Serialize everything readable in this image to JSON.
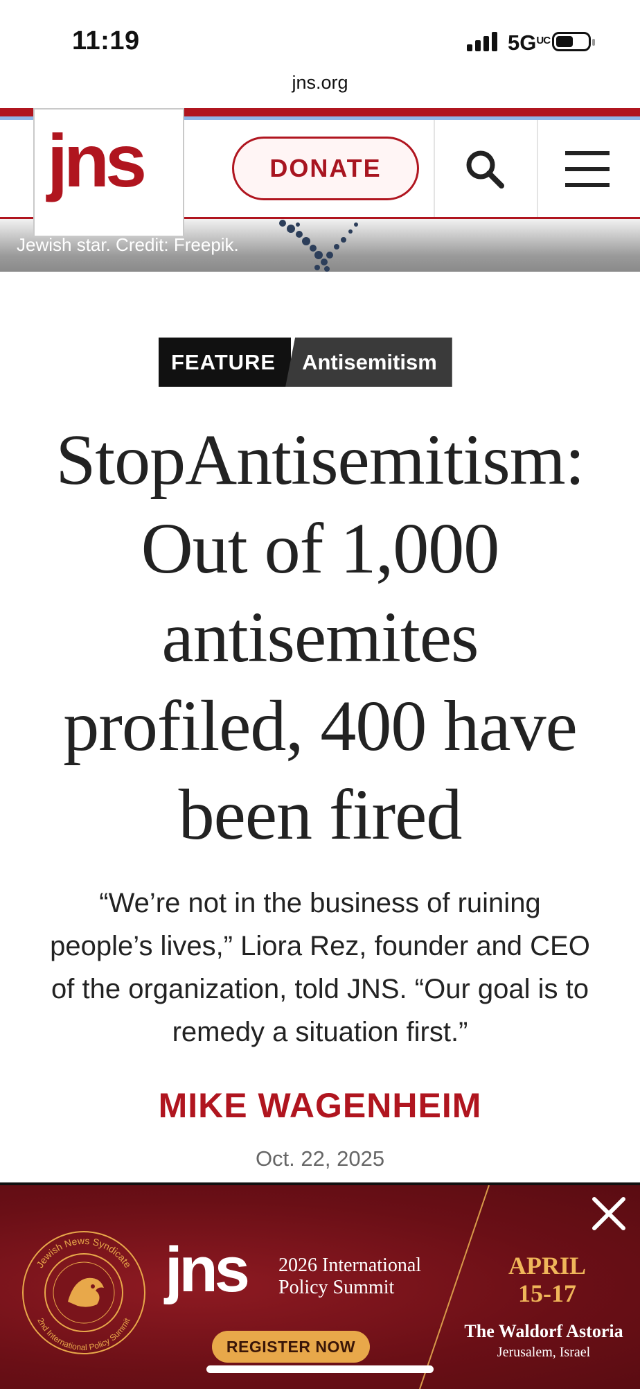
{
  "status_bar": {
    "time": "11:19",
    "network": "5G",
    "network_suffix": "UC"
  },
  "browser": {
    "url": "jns.org"
  },
  "site_header": {
    "logo": "jns",
    "donate_label": "DONATE"
  },
  "hero": {
    "caption": "Jewish star. Credit: Freepik."
  },
  "article": {
    "tag_feature": "FEATURE",
    "tag_topic": "Antisemitism",
    "headline_lines": [
      "StopAntisemitism:",
      "Out of 1,000",
      "antisemites",
      "profiled, 400 have",
      "been fired"
    ],
    "dek_lines": [
      "“We’re not in the business of ruining",
      "people’s lives,” Liora Rez, founder and CEO",
      "of the organization, told JNS. “Our goal is to",
      "remedy a situation first.”"
    ],
    "author": "MIKE WAGENHEIM",
    "date": "Oct. 22, 2025"
  },
  "ad": {
    "logo": "jns",
    "summit_line1": "2026 International",
    "summit_line2": "Policy Summit",
    "register_label": "REGISTER NOW",
    "month": "APRIL",
    "days": "15-17",
    "venue": "The Waldorf Astoria",
    "city": "Jerusalem, Israel",
    "seal_top": "Jewish News Syndicate",
    "seal_bottom": "2nd International Policy Summit"
  },
  "colors": {
    "brand_red": "#b0151f",
    "ad_gold": "#e8a84a"
  }
}
